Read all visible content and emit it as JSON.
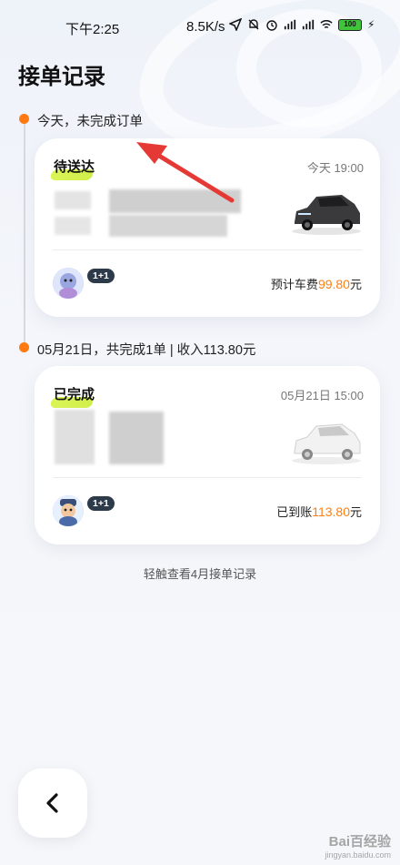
{
  "status_bar": {
    "time": "下午2:25",
    "network_speed": "8.5K/s",
    "battery": "100",
    "icons": [
      "location-arrow-icon",
      "mute-icon",
      "alarm-icon",
      "signal-hd-icon",
      "signal-hd-icon",
      "wifi-icon",
      "battery-icon",
      "charging-icon"
    ]
  },
  "page": {
    "title": "接单记录"
  },
  "sections": [
    {
      "header": "今天，未完成订单",
      "card": {
        "status": "待送达",
        "time": "今天 19:00",
        "fare_label": "预计车费",
        "fare_amount": "99.80",
        "fare_unit": "元",
        "badge": "1+1",
        "car_color": "#3a3a3c"
      }
    },
    {
      "header": "05月21日，共完成1单 | 收入113.80元",
      "card": {
        "status": "已完成",
        "time": "05月21日 15:00",
        "fare_label": "已到账",
        "fare_amount": "113.80",
        "fare_unit": "元",
        "badge": "1+1",
        "car_color": "#f0f0f0"
      }
    }
  ],
  "footer": {
    "history_link": "轻触查看4月接单记录"
  },
  "watermark": {
    "text": "Bai百经验",
    "sub": "jingyan.baidu.com"
  },
  "colors": {
    "accent_orange": "#ff7f0e",
    "highlight_green": "#d5f23a",
    "arrow_red": "#e53935"
  }
}
